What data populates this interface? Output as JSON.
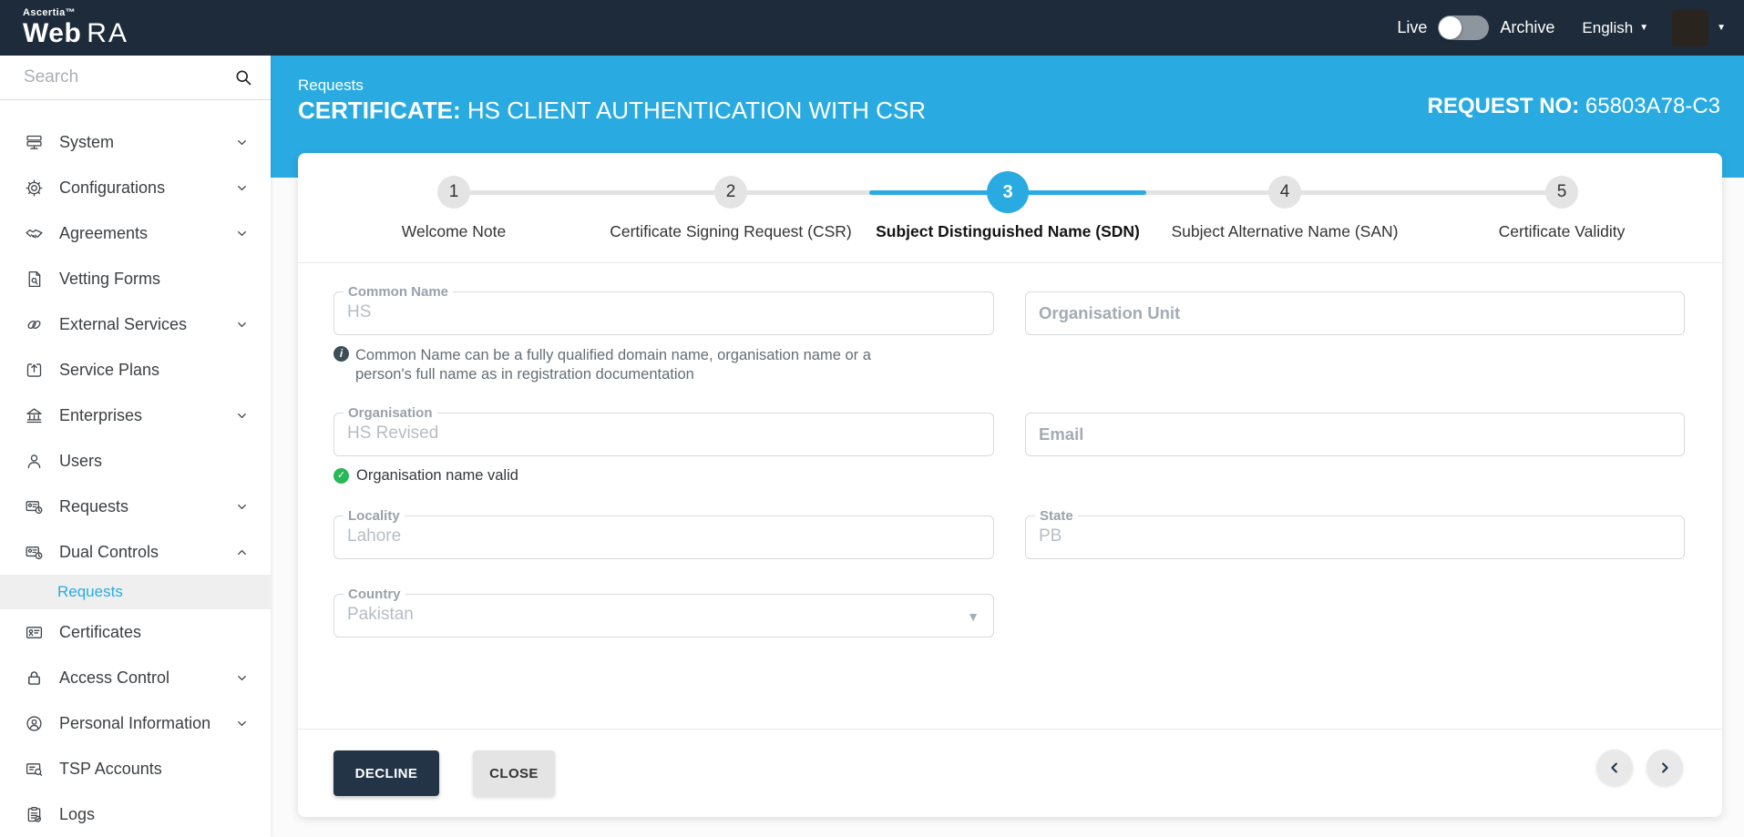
{
  "topbar": {
    "brand_top": "Ascertia™",
    "brand_web": "Web",
    "brand_ra": "RA",
    "live_label": "Live",
    "archive_label": "Archive",
    "language": "English"
  },
  "sidebar": {
    "search_placeholder": "Search",
    "items": [
      {
        "label": "System",
        "has_children": true,
        "expanded": false
      },
      {
        "label": "Configurations",
        "has_children": true,
        "expanded": false
      },
      {
        "label": "Agreements",
        "has_children": true,
        "expanded": false
      },
      {
        "label": "Vetting Forms",
        "has_children": false
      },
      {
        "label": "External Services",
        "has_children": true,
        "expanded": false
      },
      {
        "label": "Service Plans",
        "has_children": false
      },
      {
        "label": "Enterprises",
        "has_children": true,
        "expanded": false
      },
      {
        "label": "Users",
        "has_children": false
      },
      {
        "label": "Requests",
        "has_children": true,
        "expanded": false
      },
      {
        "label": "Dual Controls",
        "has_children": true,
        "expanded": true,
        "children": [
          {
            "label": "Requests",
            "active": true
          }
        ]
      },
      {
        "label": "Certificates",
        "has_children": false
      },
      {
        "label": "Access Control",
        "has_children": true,
        "expanded": false
      },
      {
        "label": "Personal Information",
        "has_children": true,
        "expanded": false
      },
      {
        "label": "TSP Accounts",
        "has_children": false
      },
      {
        "label": "Logs",
        "has_children": false
      }
    ]
  },
  "header": {
    "breadcrumb": "Requests",
    "title_prefix": "CERTIFICATE:",
    "title": " HS CLIENT AUTHENTICATION WITH CSR",
    "request_no_label": "REQUEST NO:",
    "request_no": " 65803A78-C3"
  },
  "stepper": {
    "steps": [
      {
        "num": "1",
        "label": "Welcome Note",
        "state": "inactive"
      },
      {
        "num": "2",
        "label": "Certificate Signing Request (CSR)",
        "state": "inactive"
      },
      {
        "num": "3",
        "label": "Subject Distinguished Name (SDN)",
        "state": "active"
      },
      {
        "num": "4",
        "label": "Subject Alternative Name (SAN)",
        "state": "inactive"
      },
      {
        "num": "5",
        "label": "Certificate Validity",
        "state": "inactive"
      }
    ]
  },
  "form": {
    "common_name": {
      "label": "Common Name",
      "value": "HS"
    },
    "common_name_hint": "Common Name can be a fully qualified domain name, organisation name or a person's full name as in registration documentation",
    "organisation_unit": {
      "placeholder": "Organisation Unit"
    },
    "organisation": {
      "label": "Organisation",
      "value": "HS Revised"
    },
    "organisation_valid": "Organisation name valid",
    "email": {
      "placeholder": "Email"
    },
    "locality": {
      "label": "Locality",
      "value": "Lahore"
    },
    "state": {
      "label": "State",
      "value": "PB"
    },
    "country": {
      "label": "Country",
      "value": "Pakistan"
    }
  },
  "footer": {
    "decline_label": "DECLINE",
    "close_label": "CLOSE"
  },
  "colors": {
    "accent": "#29abe2",
    "topbar_bg": "#1d2b3a",
    "success": "#27b857",
    "decline_bg": "#223446"
  }
}
